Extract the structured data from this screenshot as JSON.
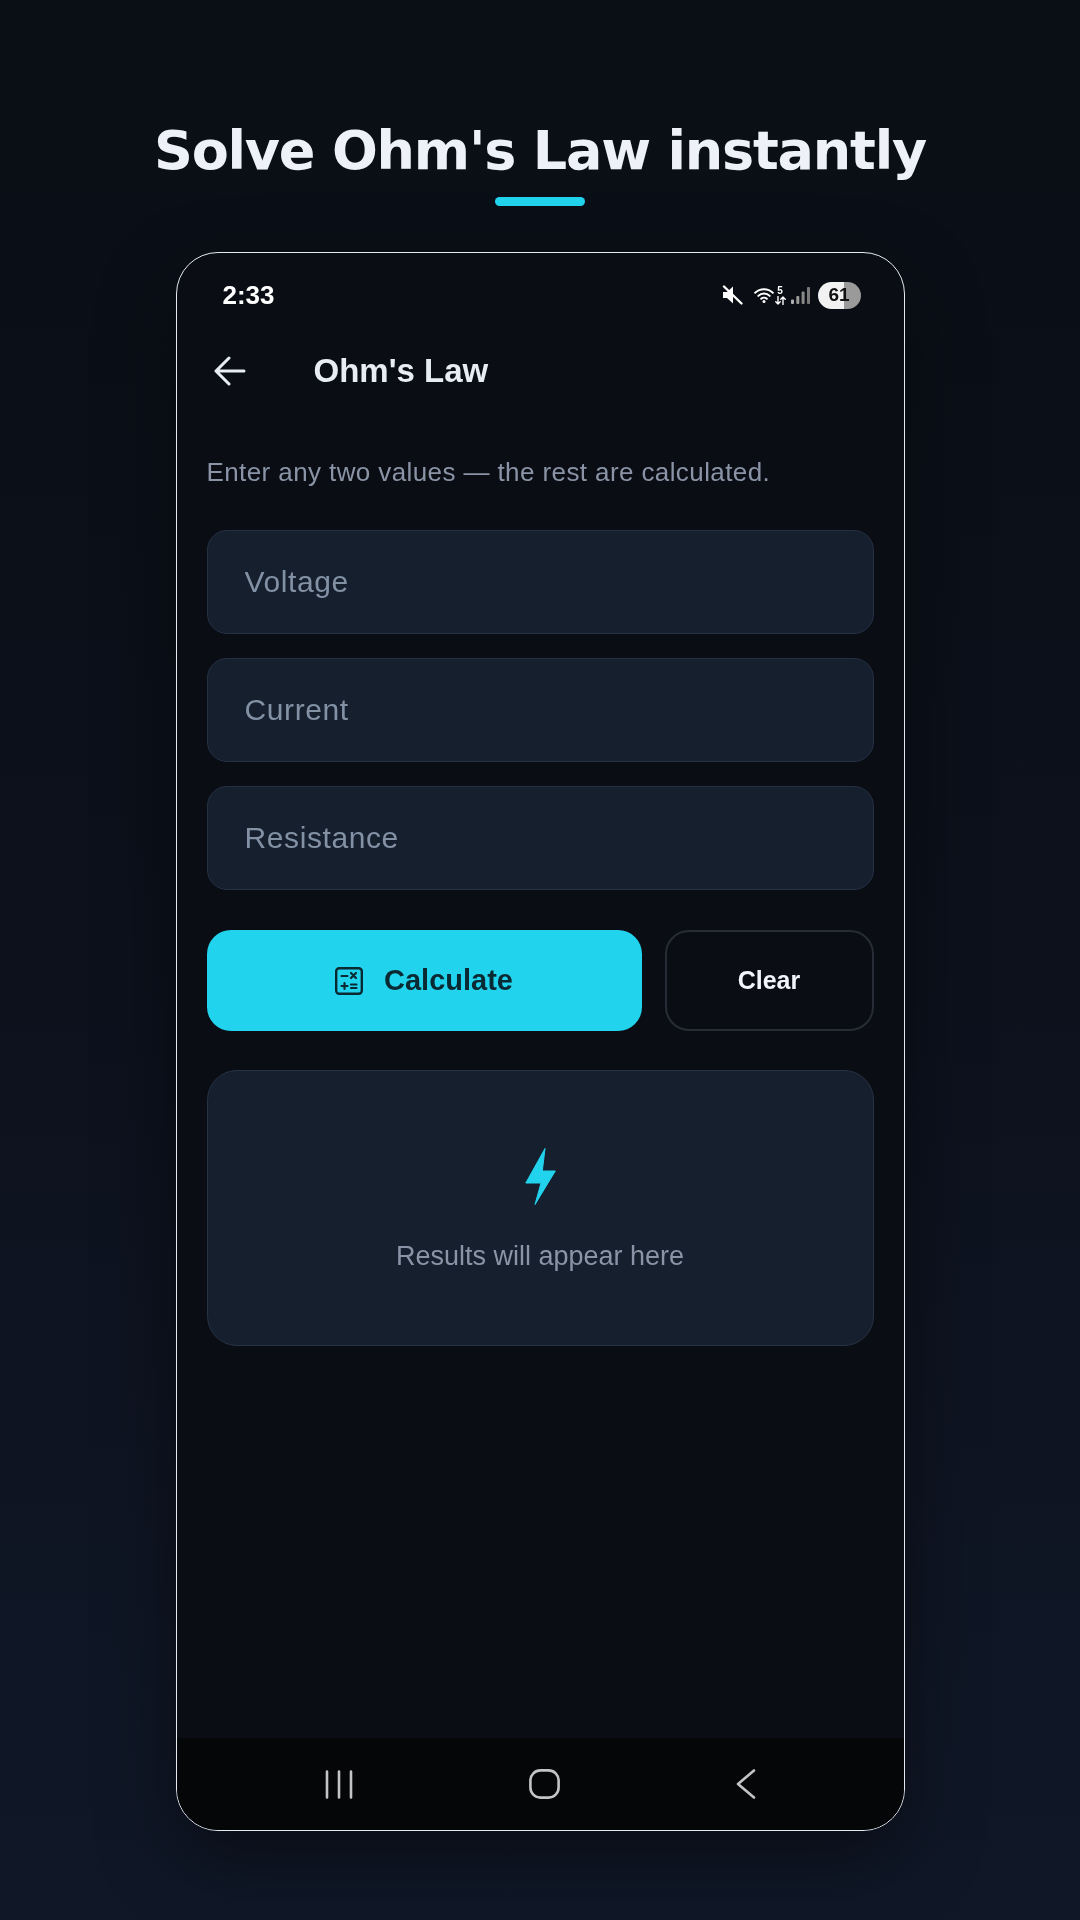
{
  "headline": {
    "title": "Solve Ohm's Law instantly"
  },
  "status_bar": {
    "time": "2:33",
    "network_type": "5",
    "battery": "61"
  },
  "app_bar": {
    "title": "Ohm's Law"
  },
  "instructions": "Enter any two values — the rest are calculated.",
  "fields": [
    {
      "placeholder": "Voltage"
    },
    {
      "placeholder": "Current"
    },
    {
      "placeholder": "Resistance"
    }
  ],
  "buttons": [
    {
      "kind": "primary",
      "label": "Calculate"
    },
    {
      "kind": "outline",
      "label": "Clear"
    }
  ],
  "results": {
    "message": "Results will appear here"
  }
}
